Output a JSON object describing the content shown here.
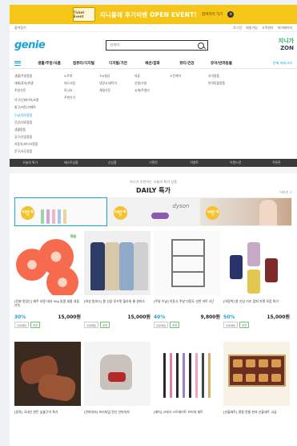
{
  "top_banner": {
    "logo_text": "Ticket Event",
    "text": "지니몰에 후기이벤 OPEN EVENT!",
    "link": "참여하러 가기",
    "close": "×"
  },
  "utility": {
    "left": "즐겨찾기",
    "right": [
      "로그인",
      "회원가입",
      "고객센터",
      "마이페이지"
    ]
  },
  "header": {
    "logo": "genie",
    "search_placeholder": "검색어",
    "zone_top": "지니가",
    "zone_bottom": "ZON"
  },
  "gnb": {
    "items": [
      "생활/주방/식품",
      "컴퓨터/디지털",
      "디지털/가전",
      "패션/잡화",
      "뷰티/건강",
      "유아/반려동물"
    ],
    "end": "전체 카테고리"
  },
  "mega": {
    "columns": [
      [
        "생활/주방용품",
        "세제/휴지/위생",
        "주방가전",
        "",
        "가구/인테리어/조명",
        "침구/커튼/카페트",
        "수납/정리용품",
        "건강/의료용품",
        "생활용품",
        "공구/산업용품",
        "자동차/바이크용품",
        "문구/사무용품"
      ],
      [
        "노트북",
        "데스크탑",
        "모니터",
        "주변기기"
      ],
      [
        "TV/영상",
        "냉장고/세탁기",
        "계절가전"
      ],
      [
        "의류",
        "신발/가방",
        "시계/주얼리"
      ],
      [
        "스킨케어"
      ],
      [
        "유아용품",
        "반려동물용품"
      ]
    ]
  },
  "darkbar": {
    "items": [
      "오늘의 특가",
      "베스트상품",
      "신상품",
      "기획전",
      "이벤트",
      "브랜드관",
      "쿠폰존"
    ]
  },
  "daily": {
    "sub": "지니가 추천하는 오늘의 특가 상품",
    "title": "DAILY 특가",
    "more": "더보기 >",
    "badge": "오늘의 특가",
    "dyson_label": "dyson"
  },
  "products_row1": [
    {
      "title": "[진짜 맛있는] 제주 자몽 대과 5kg 달콤 새콤 과즙 가득",
      "discount": "30%",
      "price": "15,000원",
      "orig": "21,500원",
      "tags": [
        "무료배송",
        "추천"
      ],
      "brand": "정원"
    },
    {
      "title": "[여성 원피스] 봄 신상 루즈핏 플라워 롱 원피스",
      "discount": "",
      "price": "15,000원",
      "orig": "",
      "tags": [
        "무료배송",
        "추천"
      ],
      "brand": ""
    },
    {
      "title": "[주방 수납] 이동식 주방 다용도 선반 카트 3단",
      "discount": "40%",
      "price": "9,800원",
      "orig": "16,300원",
      "tags": [
        "무료배송",
        "추천"
      ],
      "brand": ""
    },
    {
      "title": "[아동복] 봄 신상 키즈 점퍼 자켓 모음 특가",
      "discount": "50%",
      "price": "15,000원",
      "orig": "30,000원",
      "tags": [
        "무료배송",
        "추천"
      ],
      "brand": ""
    }
  ],
  "products_row2": [
    {
      "title": "[정육] 국내산 한돈 숯불구이 특가"
    },
    {
      "title": "[안마의자] 프리미엄 전신 안마의자"
    },
    {
      "title": "[헤어] 고데기 스트레이트 브러쉬 세트"
    },
    {
      "title": "[선물세트] 명절 전통 한과 선물세트 고급"
    }
  ]
}
